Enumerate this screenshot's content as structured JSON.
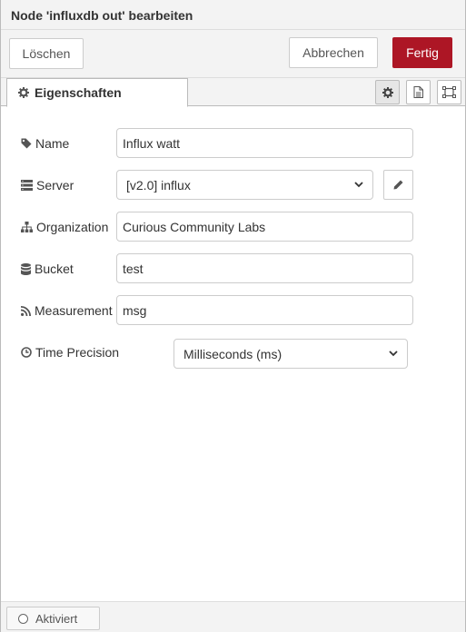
{
  "tray": {
    "title": "Node 'influxdb out' bearbeiten"
  },
  "toolbar": {
    "delete_label": "Löschen",
    "cancel_label": "Abbrechen",
    "done_label": "Fertig"
  },
  "tabs": {
    "properties_label": "Eigenschaften",
    "icons": [
      "gear-icon",
      "description-icon",
      "appearance-icon"
    ]
  },
  "form": {
    "name": {
      "label": "Name",
      "value": "Influx watt",
      "icon": "tag-icon"
    },
    "server": {
      "label": "Server",
      "value": "[v2.0] influx",
      "icon": "server-icon"
    },
    "organization": {
      "label": "Organization",
      "value": "Curious Community Labs",
      "icon": "sitemap-icon"
    },
    "bucket": {
      "label": "Bucket",
      "value": "test",
      "icon": "database-icon"
    },
    "measurement": {
      "label": "Measurement",
      "value": "msg",
      "icon": "rss-icon"
    },
    "time_precision": {
      "label": "Time Precision",
      "value": "Milliseconds (ms)",
      "icon": "clock-icon"
    }
  },
  "footer": {
    "enabled_label": "Aktiviert"
  },
  "colors": {
    "primary": "#ad1625",
    "panel": "#f3f3f3",
    "border": "#cccccc"
  }
}
